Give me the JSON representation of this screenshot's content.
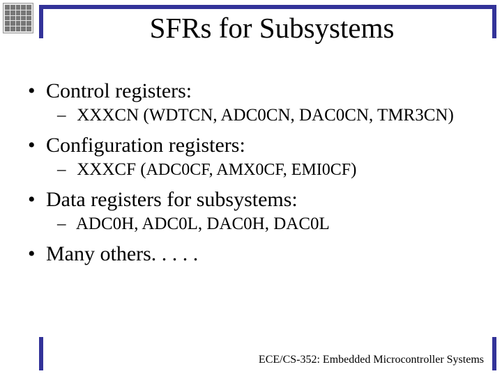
{
  "title": "SFRs for Subsystems",
  "bullets": {
    "control": {
      "label": "Control registers:",
      "sub": "XXXCN  (WDTCN, ADC0CN, DAC0CN, TMR3CN)"
    },
    "config": {
      "label": "Configuration registers:",
      "sub_prefix": "XXXCF (",
      "sub_small": "ADC0CF, AMX0CF, EMI0CF",
      "sub_suffix": ")"
    },
    "data": {
      "label": "Data registers for subsystems:",
      "sub": "ADC0H, ADC0L,    DAC0H, DAC0L"
    },
    "others": {
      "label": "Many others. . . . ."
    }
  },
  "footer": "ECE/CS-352: Embedded Microcontroller Systems"
}
